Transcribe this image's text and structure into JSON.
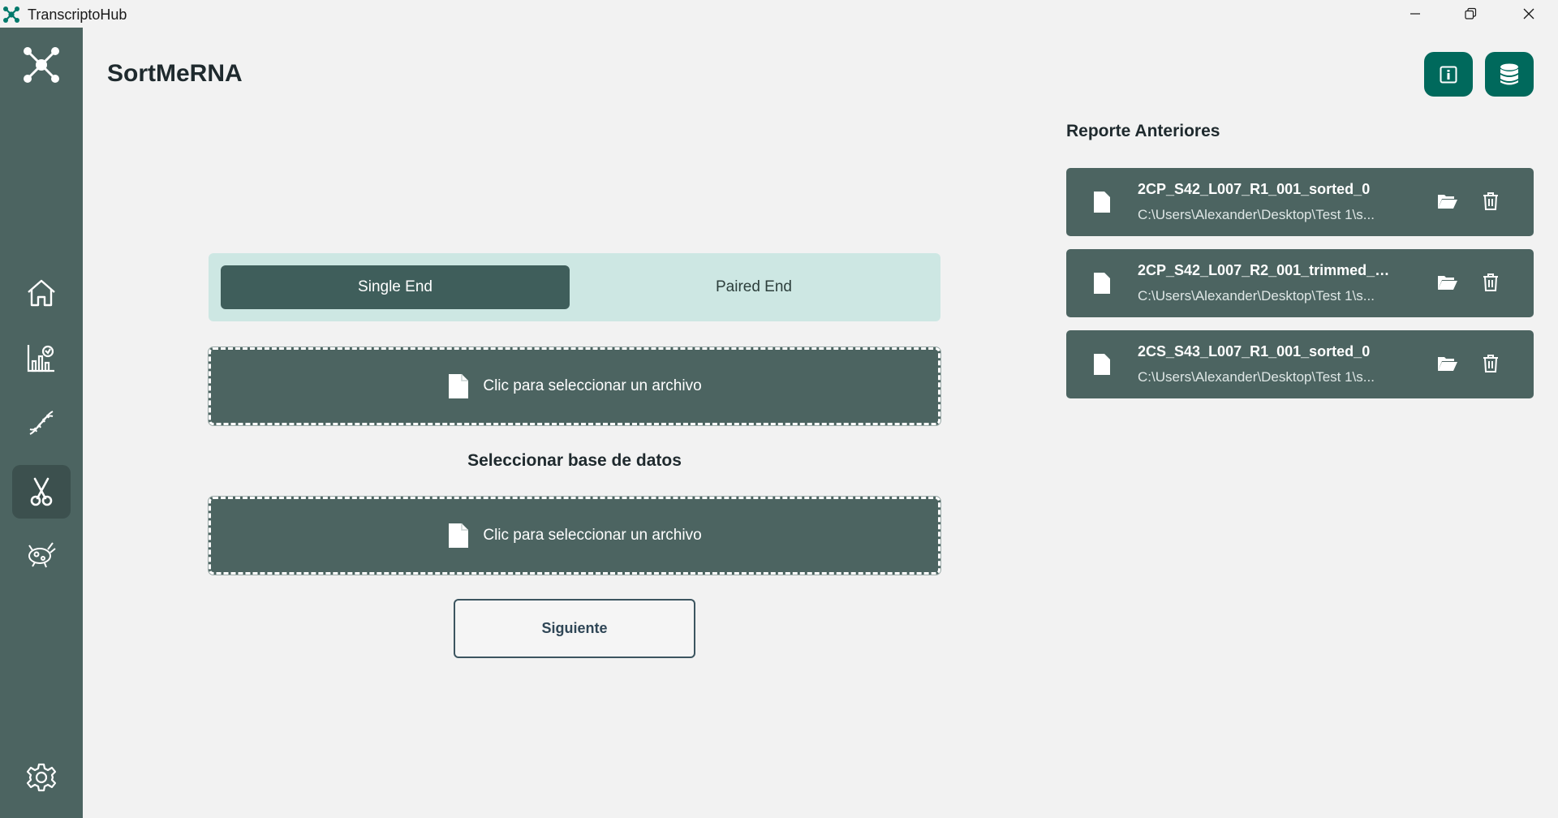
{
  "window": {
    "title": "TranscriptoHub"
  },
  "page": {
    "title": "SortMeRNA"
  },
  "mode_toggle": {
    "options": [
      "Single End",
      "Paired End"
    ],
    "selected": "Single End"
  },
  "file_picker": {
    "label": "Clic para seleccionar un archivo"
  },
  "database": {
    "heading": "Seleccionar base de datos",
    "picker_label": "Clic para seleccionar un archivo"
  },
  "actions": {
    "next_label": "Siguiente"
  },
  "reports": {
    "title": "Reporte Anteriores",
    "items": [
      {
        "name": "2CP_S42_L007_R1_001_sorted_0",
        "path": "C:\\Users\\Alexander\\Desktop\\Test 1\\s..."
      },
      {
        "name": "2CP_S42_L007_R2_001_trimmed_0_...",
        "path": "C:\\Users\\Alexander\\Desktop\\Test 1\\s..."
      },
      {
        "name": "2CS_S43_L007_R1_001_sorted_0",
        "path": "C:\\Users\\Alexander\\Desktop\\Test 1\\s..."
      }
    ]
  },
  "colors": {
    "sidebar": "#4c6461",
    "accent": "#00695c",
    "toggle_bg": "#cde7e3",
    "toggle_active": "#3f5e5b"
  }
}
